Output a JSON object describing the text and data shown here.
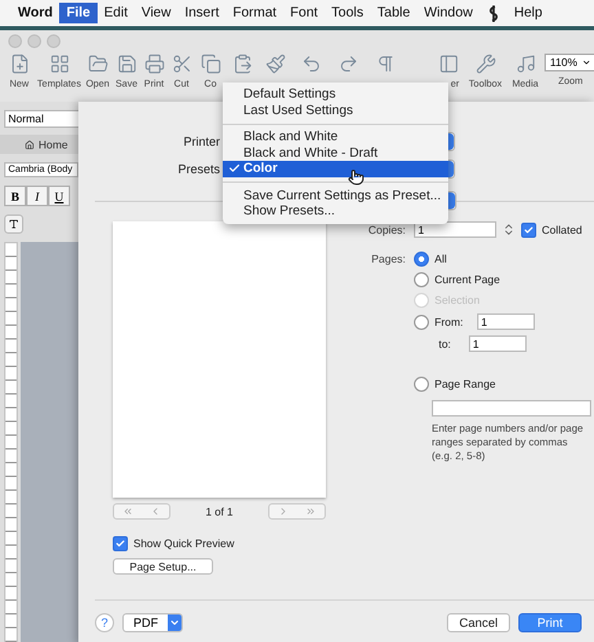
{
  "menu_bar": {
    "app_name": "Word",
    "items": [
      {
        "kind": "text",
        "label": "File",
        "selected": true
      },
      {
        "kind": "text",
        "label": "Edit",
        "selected": false
      },
      {
        "kind": "text",
        "label": "View",
        "selected": false
      },
      {
        "kind": "text",
        "label": "Insert",
        "selected": false
      },
      {
        "kind": "text",
        "label": "Format",
        "selected": false
      },
      {
        "kind": "text",
        "label": "Font",
        "selected": false
      },
      {
        "kind": "text",
        "label": "Tools",
        "selected": false
      },
      {
        "kind": "text",
        "label": "Table",
        "selected": false
      },
      {
        "kind": "text",
        "label": "Window",
        "selected": false
      },
      {
        "kind": "icon",
        "selected": false
      },
      {
        "kind": "text",
        "label": "Help",
        "selected": false
      }
    ]
  },
  "toolbar": {
    "items": [
      {
        "kind": "new",
        "label": "New"
      },
      {
        "kind": "templates",
        "label": "Templates"
      },
      {
        "kind": "open",
        "label": "Open"
      },
      {
        "kind": "save",
        "label": "Save"
      },
      {
        "kind": "print",
        "label": "Print"
      },
      {
        "kind": "cut",
        "label": "Cut"
      },
      {
        "kind": "copy",
        "label": "Co"
      },
      {
        "kind": "paste"
      },
      {
        "kind": "brush"
      },
      {
        "kind": "undo"
      },
      {
        "kind": "redo"
      },
      {
        "kind": "pilcrow"
      },
      {
        "kind": "sidebar",
        "label": "er"
      },
      {
        "kind": "toolbox",
        "label": "Toolbox"
      },
      {
        "kind": "media",
        "label": "Media"
      }
    ],
    "zoom": {
      "value": "110%",
      "label": "Zoom"
    }
  },
  "sidebar": {
    "style": "Normal",
    "tab": "Home",
    "font": "Cambria (Body",
    "format_buttons": [
      "B",
      "I",
      "U"
    ]
  },
  "print_dialog": {
    "printer_label": "Printer",
    "presets_label": "Presets",
    "preview": {
      "page_indicator": "1 of 1",
      "show_quick_preview": {
        "label": "Show Quick Preview",
        "checked": true
      },
      "page_setup": "Page Setup..."
    },
    "copies": {
      "label": "Copies:",
      "value": "1",
      "collated": {
        "label": "Collated",
        "checked": true
      }
    },
    "pages": {
      "label": "Pages:",
      "options": [
        {
          "kind": "plain",
          "label": "All",
          "selected": true,
          "disabled": false
        },
        {
          "kind": "plain",
          "label": "Current Page",
          "selected": false,
          "disabled": false
        },
        {
          "kind": "plain",
          "label": "Selection",
          "selected": false,
          "disabled": true
        },
        {
          "kind": "from",
          "label": "From:",
          "selected": false,
          "disabled": false,
          "from_value": "1",
          "to_label": "to:",
          "to_value": "1"
        },
        {
          "kind": "range",
          "label": "Page Range",
          "selected": false,
          "disabled": false,
          "hint": "Enter page numbers and/or page ranges separated by commas (e.g. 2, 5-8)"
        }
      ]
    },
    "footer": {
      "help": "?",
      "pdf": "PDF",
      "cancel": "Cancel",
      "print": "Print"
    }
  },
  "presets_menu": {
    "items": [
      {
        "kind": "item",
        "label": "Default Settings",
        "selected": false
      },
      {
        "kind": "item",
        "label": "Last Used Settings",
        "selected": false
      },
      {
        "kind": "separator"
      },
      {
        "kind": "item",
        "label": "Black and White",
        "selected": false
      },
      {
        "kind": "item",
        "label": "Black and White - Draft",
        "selected": false
      },
      {
        "kind": "item",
        "label": "Color",
        "selected": true
      },
      {
        "kind": "separator"
      },
      {
        "kind": "item",
        "label": "Save Current Settings as Preset...",
        "selected": false
      },
      {
        "kind": "item",
        "label": "Show Presets...",
        "selected": false
      }
    ]
  }
}
